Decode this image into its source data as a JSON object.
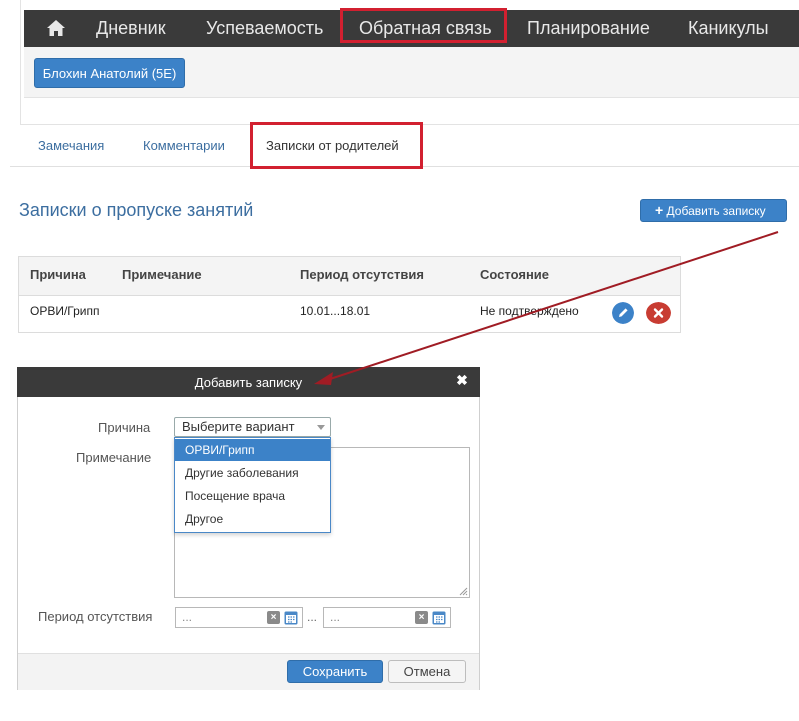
{
  "nav": {
    "home_icon": "home-icon",
    "items": [
      "Дневник",
      "Успеваемость",
      "Обратная связь",
      "Планирование",
      "Каникулы"
    ],
    "highlighted": "Обратная связь"
  },
  "student": {
    "label": "Блохин Анатолий (5Е)"
  },
  "tabs": {
    "items": [
      "Замечания",
      "Комментарии"
    ],
    "active": "Записки от родителей"
  },
  "section": {
    "title": "Записки о пропуске занятий",
    "add_button": "Добавить записку",
    "add_icon": "plus-icon"
  },
  "table": {
    "headers": [
      "Причина",
      "Примечание",
      "Период отсутствия",
      "Состояние"
    ],
    "rows": [
      {
        "reason": "ОРВИ/Грипп",
        "note": "",
        "period": "10.01...18.01",
        "status": "Не подтверждено"
      }
    ],
    "edit_icon": "pencil-icon",
    "delete_icon": "close-icon",
    "edit_color": "#3c82c8",
    "delete_color": "#c83c32"
  },
  "modal": {
    "title": "Добавить записку",
    "close_icon": "close-icon",
    "reason_label": "Причина",
    "note_label": "Примечание",
    "period_label": "Период отсутствия",
    "select_placeholder": "Выберите вариант",
    "options": [
      "ОРВИ/Грипп",
      "Другие заболевания",
      "Посещение врача",
      "Другое"
    ],
    "highlighted_option": "ОРВИ/Грипп",
    "date_from": "...",
    "date_to": "...",
    "date_separator": "...",
    "save": "Сохранить",
    "cancel": "Отмена"
  },
  "colors": {
    "navbar": "#3a3a3a",
    "accent": "#3c82c8",
    "highlight_frame": "#d22030",
    "arrow": "#a01c24"
  }
}
